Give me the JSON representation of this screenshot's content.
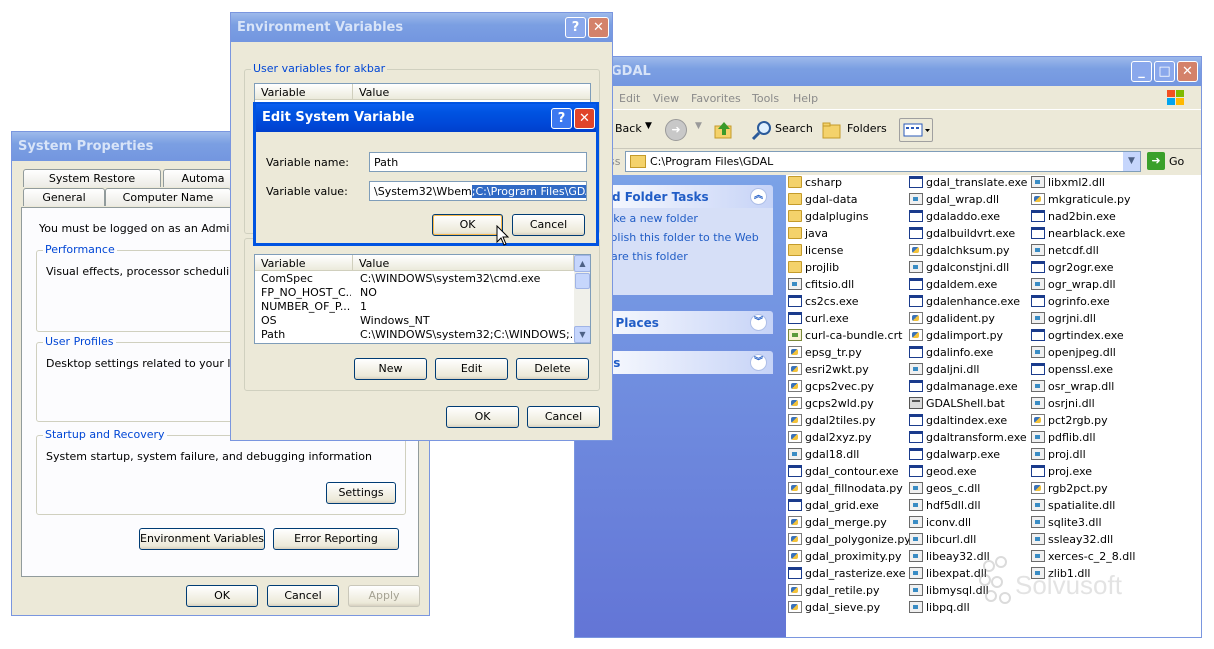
{
  "sysprops": {
    "title": "System Properties",
    "tabs_top": [
      "System Restore",
      "Automa"
    ],
    "tabs_bottom": [
      "General",
      "Computer Name"
    ],
    "admin_note": "You must be logged on as an Administrat",
    "performance": {
      "label": "Performance",
      "text": "Visual effects, processor scheduling, m"
    },
    "profiles": {
      "label": "User Profiles",
      "text": "Desktop settings related to your logon"
    },
    "startup": {
      "label": "Startup and Recovery",
      "text": "System startup, system failure, and debugging information",
      "settings_button": "Settings"
    },
    "env_button": "Environment Variables",
    "error_button": "Error Reporting",
    "ok": "OK",
    "cancel": "Cancel",
    "apply": "Apply"
  },
  "envvars": {
    "title": "Environment Variables",
    "help": "?",
    "close": "X",
    "user_group_label": "User variables for akbar",
    "columns": [
      "Variable",
      "Value"
    ],
    "system_rows": [
      {
        "var": "ComSpec",
        "val": "C:\\WINDOWS\\system32\\cmd.exe"
      },
      {
        "var": "FP_NO_HOST_C...",
        "val": "NO"
      },
      {
        "var": "NUMBER_OF_P...",
        "val": "1"
      },
      {
        "var": "OS",
        "val": "Windows_NT"
      },
      {
        "var": "Path",
        "val": "C:\\WINDOWS\\system32;C:\\WINDOWS;..."
      }
    ],
    "new": "New",
    "edit": "Edit",
    "delete": "Delete",
    "ok": "OK",
    "cancel": "Cancel"
  },
  "editdlg": {
    "title": "Edit System Variable",
    "help": "?",
    "close": "X",
    "name_label": "Variable name:",
    "name_value": "Path",
    "value_label": "Variable value:",
    "value_plain": "\\System32\\Wbem",
    "value_selected": ";C:\\Program Files\\GDAL",
    "ok": "OK",
    "cancel": "Cancel"
  },
  "explorer": {
    "title": "GDAL",
    "window_buttons": [
      "_",
      "□",
      "X"
    ],
    "menu": [
      "Edit",
      "View",
      "Favorites",
      "Tools",
      "Help"
    ],
    "toolbar": {
      "back": "Back",
      "search": "Search",
      "folders": "Folders"
    },
    "address_label": "ss",
    "address_value": "C:\\Program Files\\GDAL",
    "go": "Go",
    "tasks": {
      "file_folder": {
        "title": "e and Folder Tasks",
        "links": [
          "Make a new folder",
          "Publish this folder to the Web",
          "Share this folder"
        ]
      },
      "other_places": "ther Places",
      "details": "etails"
    },
    "columns": [
      [
        {
          "name": "csharp",
          "type": "folder"
        },
        {
          "name": "gdal-data",
          "type": "folder"
        },
        {
          "name": "gdalplugins",
          "type": "folder"
        },
        {
          "name": "java",
          "type": "folder"
        },
        {
          "name": "license",
          "type": "folder"
        },
        {
          "name": "projlib",
          "type": "folder"
        },
        {
          "name": "cfitsio.dll",
          "type": "dll"
        },
        {
          "name": "cs2cs.exe",
          "type": "exe"
        },
        {
          "name": "curl.exe",
          "type": "exe"
        },
        {
          "name": "curl-ca-bundle.crt",
          "type": "crt"
        },
        {
          "name": "epsg_tr.py",
          "type": "py"
        },
        {
          "name": "esri2wkt.py",
          "type": "py"
        },
        {
          "name": "gcps2vec.py",
          "type": "py"
        },
        {
          "name": "gcps2wld.py",
          "type": "py"
        },
        {
          "name": "gdal2tiles.py",
          "type": "py"
        },
        {
          "name": "gdal2xyz.py",
          "type": "py"
        },
        {
          "name": "gdal18.dll",
          "type": "dll"
        },
        {
          "name": "gdal_contour.exe",
          "type": "exe"
        },
        {
          "name": "gdal_fillnodata.py",
          "type": "py"
        },
        {
          "name": "gdal_grid.exe",
          "type": "exe"
        },
        {
          "name": "gdal_merge.py",
          "type": "py"
        },
        {
          "name": "gdal_polygonize.py",
          "type": "py"
        },
        {
          "name": "gdal_proximity.py",
          "type": "py"
        },
        {
          "name": "gdal_rasterize.exe",
          "type": "exe"
        },
        {
          "name": "gdal_retile.py",
          "type": "py"
        },
        {
          "name": "gdal_sieve.py",
          "type": "py"
        }
      ],
      [
        {
          "name": "gdal_translate.exe",
          "type": "exe"
        },
        {
          "name": "gdal_wrap.dll",
          "type": "dll"
        },
        {
          "name": "gdaladdo.exe",
          "type": "exe"
        },
        {
          "name": "gdalbuildvrt.exe",
          "type": "exe"
        },
        {
          "name": "gdalchksum.py",
          "type": "py"
        },
        {
          "name": "gdalconstjni.dll",
          "type": "dll"
        },
        {
          "name": "gdaldem.exe",
          "type": "exe"
        },
        {
          "name": "gdalenhance.exe",
          "type": "exe"
        },
        {
          "name": "gdalident.py",
          "type": "py"
        },
        {
          "name": "gdalimport.py",
          "type": "py"
        },
        {
          "name": "gdalinfo.exe",
          "type": "exe"
        },
        {
          "name": "gdaljni.dll",
          "type": "dll"
        },
        {
          "name": "gdalmanage.exe",
          "type": "exe"
        },
        {
          "name": "GDALShell.bat",
          "type": "bat"
        },
        {
          "name": "gdaltindex.exe",
          "type": "exe"
        },
        {
          "name": "gdaltransform.exe",
          "type": "exe"
        },
        {
          "name": "gdalwarp.exe",
          "type": "exe"
        },
        {
          "name": "geod.exe",
          "type": "exe"
        },
        {
          "name": "geos_c.dll",
          "type": "dll"
        },
        {
          "name": "hdf5dll.dll",
          "type": "dll"
        },
        {
          "name": "iconv.dll",
          "type": "dll"
        },
        {
          "name": "libcurl.dll",
          "type": "dll"
        },
        {
          "name": "libeay32.dll",
          "type": "dll"
        },
        {
          "name": "libexpat.dll",
          "type": "dll"
        },
        {
          "name": "libmysql.dll",
          "type": "dll"
        },
        {
          "name": "libpq.dll",
          "type": "dll"
        }
      ],
      [
        {
          "name": "libxml2.dll",
          "type": "dll"
        },
        {
          "name": "mkgraticule.py",
          "type": "py"
        },
        {
          "name": "nad2bin.exe",
          "type": "exe"
        },
        {
          "name": "nearblack.exe",
          "type": "exe"
        },
        {
          "name": "netcdf.dll",
          "type": "dll"
        },
        {
          "name": "ogr2ogr.exe",
          "type": "exe"
        },
        {
          "name": "ogr_wrap.dll",
          "type": "dll"
        },
        {
          "name": "ogrinfo.exe",
          "type": "exe"
        },
        {
          "name": "ogrjni.dll",
          "type": "dll"
        },
        {
          "name": "ogrtindex.exe",
          "type": "exe"
        },
        {
          "name": "openjpeg.dll",
          "type": "dll"
        },
        {
          "name": "openssl.exe",
          "type": "exe"
        },
        {
          "name": "osr_wrap.dll",
          "type": "dll"
        },
        {
          "name": "osrjni.dll",
          "type": "dll"
        },
        {
          "name": "pct2rgb.py",
          "type": "py"
        },
        {
          "name": "pdflib.dll",
          "type": "dll"
        },
        {
          "name": "proj.dll",
          "type": "dll"
        },
        {
          "name": "proj.exe",
          "type": "exe"
        },
        {
          "name": "rgb2pct.py",
          "type": "py"
        },
        {
          "name": "spatialite.dll",
          "type": "dll"
        },
        {
          "name": "sqlite3.dll",
          "type": "dll"
        },
        {
          "name": "ssleay32.dll",
          "type": "dll"
        },
        {
          "name": "xerces-c_2_8.dll",
          "type": "dll"
        },
        {
          "name": "zlib1.dll",
          "type": "dll"
        }
      ]
    ]
  },
  "watermark": "Solvusoft",
  "colors": {
    "title_active": "#0053e1",
    "title_inactive": "#7b9fe2",
    "face": "#ece9d8",
    "selection": "#316ac5",
    "task_link": "#215dc6"
  }
}
